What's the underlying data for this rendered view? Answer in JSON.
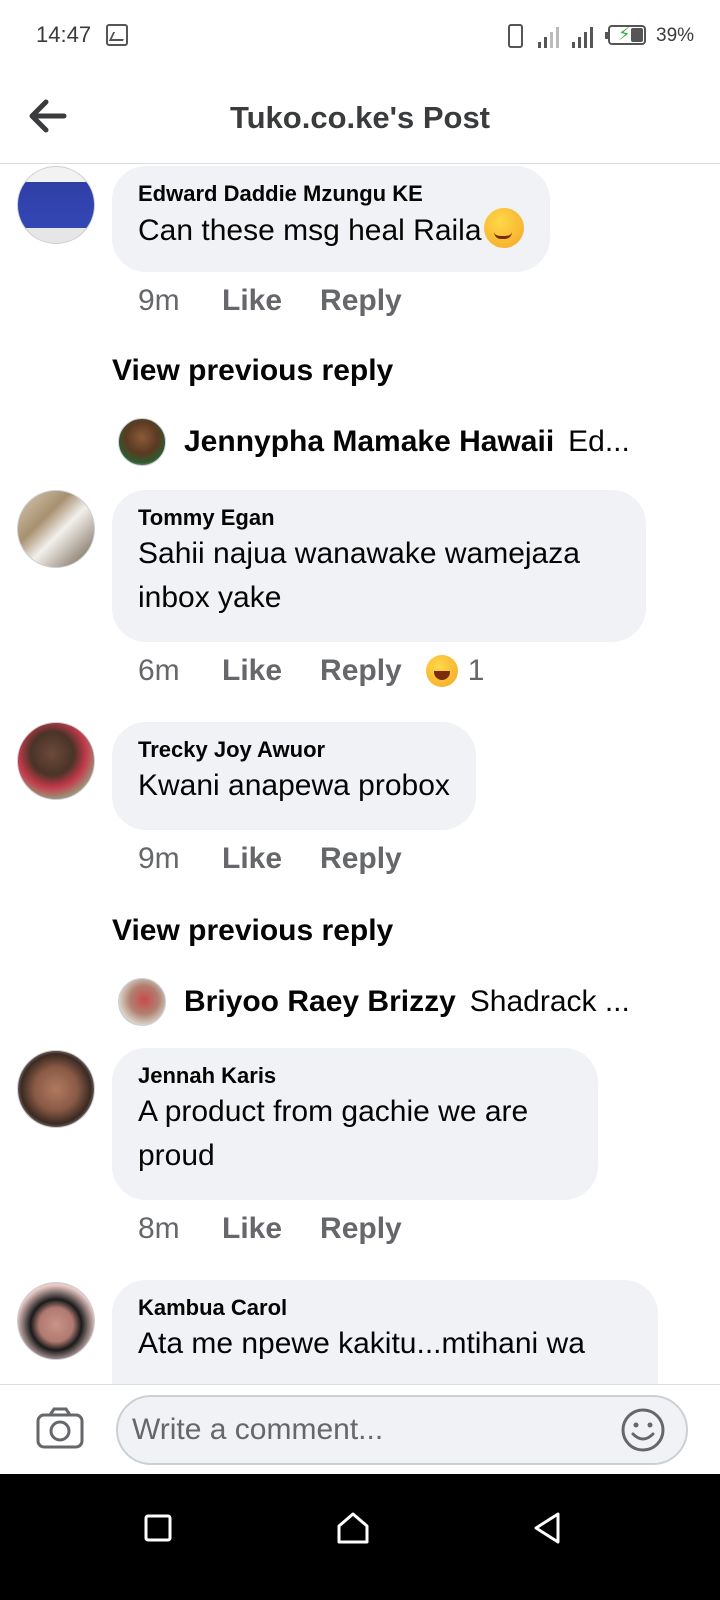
{
  "status_bar": {
    "time": "14:47",
    "battery_percent": "39%"
  },
  "header": {
    "title": "Tuko.co.ke's Post"
  },
  "comments": [
    {
      "author": "Edward Daddie Mzungu KE",
      "text": "Can these msg heal Raila",
      "emoji": "smirk-emoji",
      "time": "9m",
      "like": "Like",
      "reply": "Reply"
    },
    {
      "author": "Tommy Egan",
      "text": "Sahii najua wanawake wamejaza inbox yake",
      "time": "6m",
      "like": "Like",
      "reply": "Reply",
      "reaction": {
        "icon": "laughing-emoji",
        "count": "1"
      }
    },
    {
      "author": "Trecky Joy Awuor",
      "text": "Kwani anapewa probox",
      "time": "9m",
      "like": "Like",
      "reply": "Reply"
    },
    {
      "author": "Jennah Karis",
      "text": "A product from gachie we are proud",
      "time": "8m",
      "like": "Like",
      "reply": "Reply"
    },
    {
      "author": "Kambua Carol",
      "text": "Ata me npewe kakitu...mtihani wa"
    }
  ],
  "view_previous": [
    {
      "label": "View previous reply",
      "reply_author": "Jennypha Mamake Hawaii",
      "reply_snippet": "Ed..."
    },
    {
      "label": "View previous reply",
      "reply_author": "Briyoo Raey Brizzy",
      "reply_snippet": "Shadrack ..."
    }
  ],
  "composer": {
    "placeholder": "Write a comment..."
  },
  "colors": {
    "bubble": "#f0f2f5",
    "secondary_text": "#65676b",
    "primary_text": "#050505"
  }
}
